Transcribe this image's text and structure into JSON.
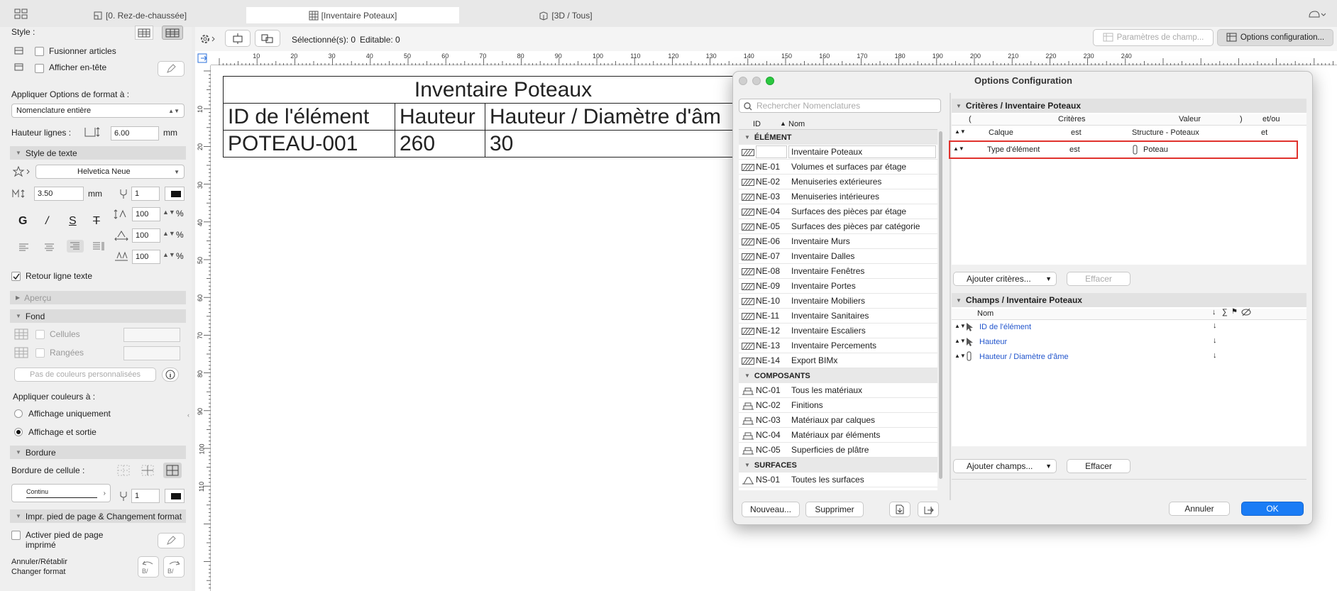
{
  "tabs": [
    {
      "label": "[0. Rez-de-chaussée]"
    },
    {
      "label": "[Inventaire Poteaux]"
    },
    {
      "label": "[3D / Tous]"
    }
  ],
  "sidebar": {
    "style_label": "Style :",
    "merge_label": "Fusionner articles",
    "header_label": "Afficher en-tête",
    "apply_options_label": "Appliquer Options de format à :",
    "apply_options_value": "Nomenclature entière",
    "row_height_label": "Hauteur lignes :",
    "row_height_value": "6.00",
    "row_height_unit": "mm",
    "text_style_header": "Style de texte",
    "font_value": "Helvetica Neue",
    "font_size_value": "3.50",
    "font_size_unit": "mm",
    "pen_value": "1",
    "b_label": "G",
    "i_label": "/",
    "u_label": "S",
    "s_label": "T",
    "pct1": "100",
    "pct2": "100",
    "pct3": "100",
    "pct_unit": "%",
    "wrap_label": "Retour ligne texte",
    "preview_header": "Aperçu",
    "fill_header": "Fond",
    "cells_label": "Cellules",
    "rows_label": "Rangées",
    "no_custom_colors": "Pas de couleurs personnalisées",
    "apply_colors_label": "Appliquer couleurs à :",
    "display_only": "Affichage uniquement",
    "display_output": "Affichage et sortie",
    "border_header": "Bordure",
    "cell_border_label": "Bordure de cellule :",
    "border_type": "Continu",
    "border_pen": "1",
    "footer_header": "Impr. pied de page & Changement format",
    "footer_enable_1": "Activer pied de page",
    "footer_enable_2": "imprimé",
    "undo_label": "Annuler/Rétablir",
    "change_format_label": "Changer format"
  },
  "toolbar": {
    "selection": "Sélectionné(s): 0",
    "editable": "Editable: 0",
    "field_params": "Paramètres de champ...",
    "config_options": "Options configuration..."
  },
  "ruler": {
    "h_ticks": [
      "10",
      "20",
      "30",
      "40",
      "50",
      "60",
      "70",
      "80",
      "90",
      "100",
      "110",
      "120",
      "130",
      "140",
      "150",
      "160",
      "170",
      "180",
      "190",
      "200",
      "210",
      "220",
      "230",
      "240"
    ],
    "v_ticks": [
      "10",
      "20",
      "30",
      "40",
      "50",
      "60",
      "70",
      "80",
      "90",
      "100",
      "110"
    ]
  },
  "schedule": {
    "title": "Inventaire Poteaux",
    "headers": [
      "ID de l'élément",
      "Hauteur",
      "Hauteur / Diamètre d'âm"
    ],
    "rows": [
      [
        "POTEAU-001",
        "260",
        "30"
      ]
    ]
  },
  "dialog": {
    "title": "Options Configuration",
    "search_placeholder": "Rechercher Nomenclatures",
    "col_id": "ID",
    "col_name": "Nom",
    "groups": [
      {
        "label": "ÉLÉMENT",
        "items": [
          {
            "id": "",
            "name": "Inventaire Poteaux"
          },
          {
            "id": "NE-01",
            "name": "Volumes et surfaces par étage"
          },
          {
            "id": "NE-02",
            "name": "Menuiseries extérieures"
          },
          {
            "id": "NE-03",
            "name": "Menuiseries intérieures"
          },
          {
            "id": "NE-04",
            "name": "Surfaces des pièces par étage"
          },
          {
            "id": "NE-05",
            "name": "Surfaces des pièces par catégorie"
          },
          {
            "id": "NE-06",
            "name": "Inventaire Murs"
          },
          {
            "id": "NE-07",
            "name": "Inventaire Dalles"
          },
          {
            "id": "NE-08",
            "name": "Inventaire Fenêtres"
          },
          {
            "id": "NE-09",
            "name": "Inventaire Portes"
          },
          {
            "id": "NE-10",
            "name": "Inventaire Mobiliers"
          },
          {
            "id": "NE-11",
            "name": "Inventaire Sanitaires"
          },
          {
            "id": "NE-12",
            "name": "Inventaire Escaliers"
          },
          {
            "id": "NE-13",
            "name": "Inventaire Percements"
          },
          {
            "id": "NE-14",
            "name": "Export BIMx"
          }
        ]
      },
      {
        "label": "COMPOSANTS",
        "items": [
          {
            "id": "NC-01",
            "name": "Tous les matériaux"
          },
          {
            "id": "NC-02",
            "name": "Finitions"
          },
          {
            "id": "NC-03",
            "name": "Matériaux par calques"
          },
          {
            "id": "NC-04",
            "name": "Matériaux par éléments"
          },
          {
            "id": "NC-05",
            "name": "Superficies de plâtre"
          }
        ]
      },
      {
        "label": "SURFACES",
        "items": [
          {
            "id": "NS-01",
            "name": "Toutes les surfaces"
          }
        ]
      }
    ],
    "btn_new": "Nouveau...",
    "btn_delete": "Supprimer",
    "criteria_header": "Critères / Inventaire Poteaux",
    "crit_cols": [
      "(",
      "Critères",
      "Valeur",
      ")",
      "et/ou"
    ],
    "criteria": [
      {
        "field": "Calque",
        "op": "est",
        "value": "Structure - Poteaux",
        "andor": "et"
      },
      {
        "field": "Type d'élément",
        "op": "est",
        "value": "Poteau",
        "andor": ""
      }
    ],
    "add_criteria": "Ajouter critères...",
    "clear1": "Effacer",
    "fields_header": "Champs / Inventaire Poteaux",
    "fields_col": "Nom",
    "fields": [
      {
        "name": "ID de l'élément"
      },
      {
        "name": "Hauteur"
      },
      {
        "name": "Hauteur / Diamètre d'âme"
      }
    ],
    "add_fields": "Ajouter champs...",
    "clear2": "Effacer",
    "cancel": "Annuler",
    "ok": "OK"
  }
}
